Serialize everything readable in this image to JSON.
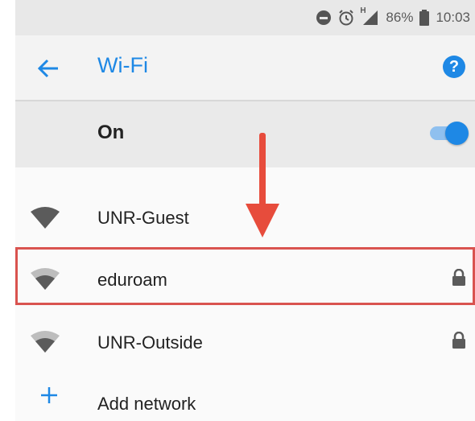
{
  "status": {
    "signal_label": "H",
    "battery": "86%",
    "time": "10:03",
    "icons": [
      "do-not-disturb-icon",
      "alarm-icon",
      "signal-icon",
      "battery-icon"
    ]
  },
  "appbar": {
    "title": "Wi-Fi",
    "help_label": "?",
    "accent": "#1e88e5"
  },
  "wifi_toggle": {
    "label": "On",
    "state": "on"
  },
  "networks": [
    {
      "name": "UNR-Guest",
      "secured": false,
      "signal": "full"
    },
    {
      "name": "eduroam",
      "secured": true,
      "signal": "medium",
      "highlighted": true
    },
    {
      "name": "UNR-Outside",
      "secured": true,
      "signal": "medium"
    }
  ],
  "add_network": {
    "label": "Add network"
  },
  "annotation": {
    "highlight_color": "#d9534f"
  }
}
